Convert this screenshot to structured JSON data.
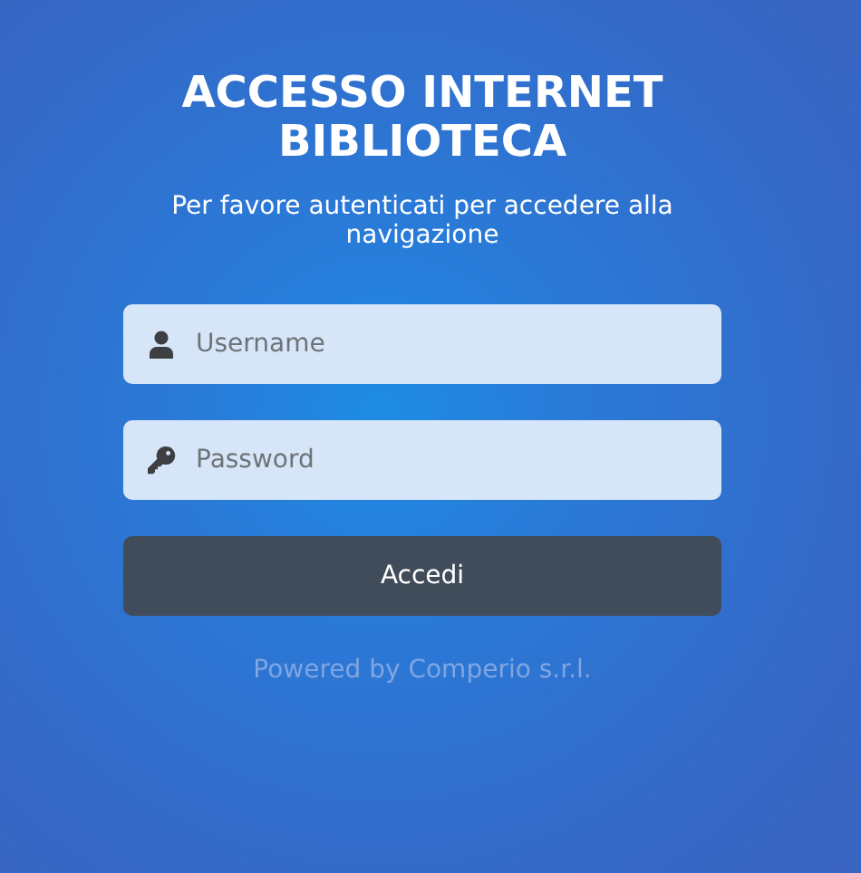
{
  "title": "ACCESSO INTERNET BIBLIOTECA",
  "subtitle": "Per favore autenticati per accedere alla navigazione",
  "fields": [
    {
      "kind": "username",
      "placeholder": "Username"
    },
    {
      "kind": "password",
      "placeholder": "Password"
    }
  ],
  "button": "Accedi",
  "footer": "Powered by Comperio s.r.l."
}
